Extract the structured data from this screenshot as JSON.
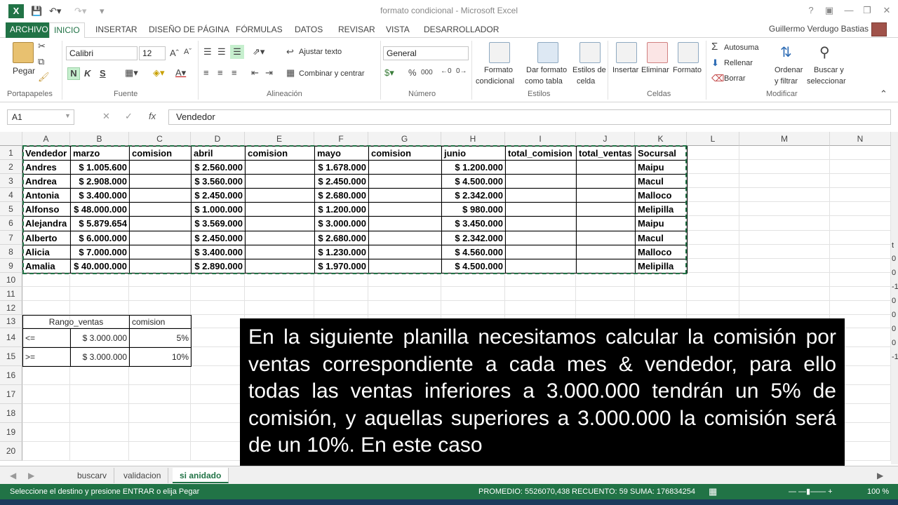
{
  "window": {
    "title": "formato condicional - Microsoft Excel",
    "app_icon": "X",
    "user_name": "Guillermo Verdugo Bastias"
  },
  "menu_tabs": [
    "ARCHIVO",
    "INICIO",
    "INSERTAR",
    "DISEÑO DE PÁGINA",
    "FÓRMULAS",
    "DATOS",
    "REVISAR",
    "VISTA",
    "DESARROLLADOR"
  ],
  "ribbon": {
    "paste_label": "Pegar",
    "groups": [
      "Portapapeles",
      "Fuente",
      "Alineación",
      "Número",
      "Estilos",
      "Celdas",
      "Modificar"
    ],
    "font_name": "Calibri",
    "font_size": "12",
    "bold": "N",
    "italic": "K",
    "underline": "S",
    "wrap_text": "Ajustar texto",
    "merge_center": "Combinar y centrar",
    "number_format": "General",
    "percent": "%",
    "thousands": "000",
    "cond_format_1": "Formato",
    "cond_format_2": "condicional",
    "table_format_1": "Dar formato",
    "table_format_2": "como tabla",
    "cell_styles_1": "Estilos de",
    "cell_styles_2": "celda",
    "insert": "Insertar",
    "delete": "Eliminar",
    "format": "Formato",
    "autosum": "Autosuma",
    "fill": "Rellenar",
    "clear": "Borrar",
    "sort_1": "Ordenar",
    "sort_2": "y filtrar",
    "find_1": "Buscar y",
    "find_2": "seleccionar"
  },
  "formula_bar": {
    "name_box": "A1",
    "fx": "fx",
    "value": "Vendedor"
  },
  "columns": [
    "A",
    "B",
    "C",
    "D",
    "E",
    "F",
    "G",
    "H",
    "I",
    "J",
    "K",
    "L",
    "M",
    "N"
  ],
  "rows": [
    "1",
    "2",
    "3",
    "4",
    "5",
    "6",
    "7",
    "8",
    "9",
    "10",
    "11",
    "12",
    "13",
    "14",
    "15",
    "16",
    "17",
    "18",
    "19",
    "20"
  ],
  "table": {
    "headers": [
      "Vendedor",
      "marzo",
      "comision",
      "abril",
      "comision",
      "mayo",
      "comision",
      "junio",
      "total_comision",
      "total_ventas",
      "Socursal"
    ],
    "rows": [
      [
        "Andres",
        "$ 1.005.600",
        "",
        "$ 2.560.000",
        "",
        "$ 1.678.000",
        "",
        "$ 1.200.000",
        "",
        "",
        "Maipu"
      ],
      [
        "Andrea",
        "$ 2.908.000",
        "",
        "$ 3.560.000",
        "",
        "$ 2.450.000",
        "",
        "$ 4.500.000",
        "",
        "",
        "Macul"
      ],
      [
        "Antonia",
        "$ 3.400.000",
        "",
        "$ 2.450.000",
        "",
        "$ 2.680.000",
        "",
        "$ 2.342.000",
        "",
        "",
        "Malloco"
      ],
      [
        "Alfonso",
        "$ 48.000.000",
        "",
        "$ 1.000.000",
        "",
        "$ 1.200.000",
        "",
        "$ 980.000",
        "",
        "",
        "Melipilla"
      ],
      [
        "Alejandra",
        "$ 5.879.654",
        "",
        "$ 3.569.000",
        "",
        "$ 3.000.000",
        "",
        "$ 3.450.000",
        "",
        "",
        "Maipu"
      ],
      [
        "Alberto",
        "$ 6.000.000",
        "",
        "$ 2.450.000",
        "",
        "$ 2.680.000",
        "",
        "$ 2.342.000",
        "",
        "",
        "Macul"
      ],
      [
        "Alicia",
        "$ 7.000.000",
        "",
        "$ 3.400.000",
        "",
        "$ 1.230.000",
        "",
        "$ 4.560.000",
        "",
        "",
        "Malloco"
      ],
      [
        "Amalia",
        "$ 40.000.000",
        "",
        "$ 2.890.000",
        "",
        "$ 1.970.000",
        "",
        "$ 4.500.000",
        "",
        "",
        "Melipilla"
      ]
    ]
  },
  "commission_table": {
    "header_range": "Rango_ventas",
    "header_commission": "comision",
    "rows": [
      [
        "<=",
        "$ 3.000.000",
        "5%"
      ],
      [
        ">=",
        "$ 3.000.000",
        "10%"
      ]
    ]
  },
  "sheet_tabs": [
    "buscarv",
    "validacion",
    "si anidado"
  ],
  "status_bar": {
    "message": "Seleccione el destino y presione ENTRAR o elija Pegar",
    "average": "PROMEDIO: 5526070,438",
    "count": "RECUENTO: 59",
    "sum": "SUMA: 176834254",
    "zoom": "100 %"
  },
  "side_glyphs": [
    "t",
    "0",
    "0",
    "-1",
    "0",
    "0",
    "0",
    "0",
    "-1"
  ],
  "overlay_text": "En la siguiente planilla necesitamos calcular la comisión por ventas correspondiente a cada mes & vendedor, para ello todas las ventas inferiores a 3.000.000 tendrán un 5% de comisión, y aquellas superiores a 3.000.000 la comisión será de un 10%. En este caso"
}
